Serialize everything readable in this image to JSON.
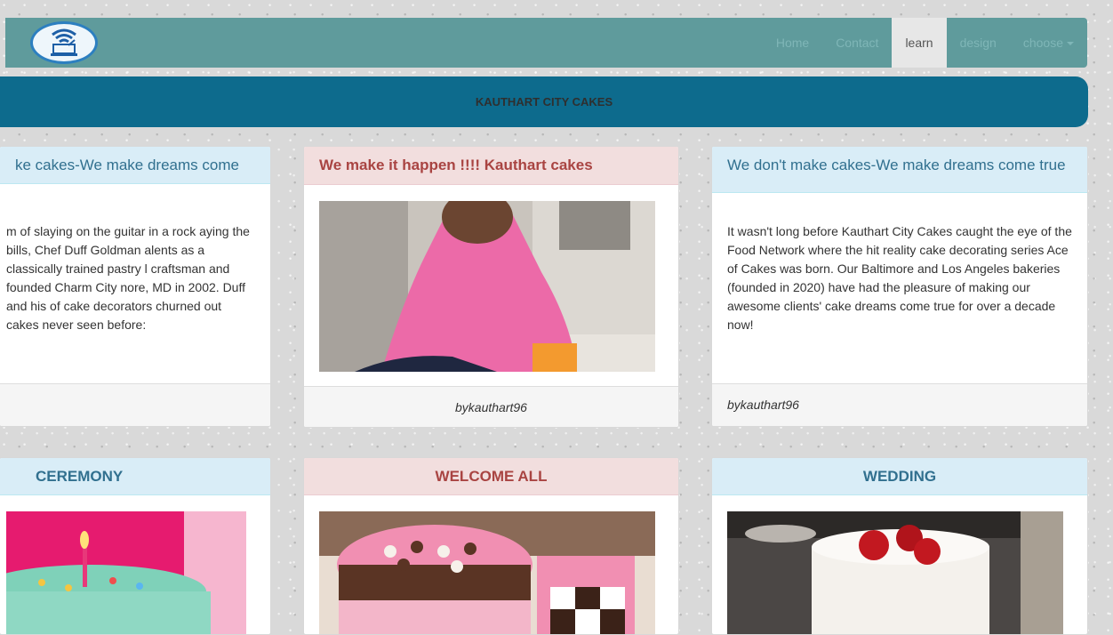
{
  "navbar": {
    "logo_icon": "wifi-laptop-logo",
    "items": [
      {
        "label": "Home",
        "active": false
      },
      {
        "label": "Contact",
        "active": false
      },
      {
        "label": "learn",
        "active": true
      },
      {
        "label": "design",
        "active": false
      },
      {
        "label": "choose",
        "active": false,
        "dropdown": true
      }
    ]
  },
  "banner": {
    "title": "KAUTHART CITY CAKES"
  },
  "cards": [
    {
      "heading": "ke cakes-We make dreams come",
      "heading_style": "info",
      "text": "m of slaying on the guitar in a rock aying the bills, Chef Duff Goldman alents as a classically trained pastry l craftsman and founded Charm City nore, MD in 2002. Duff and his of cake decorators churned out cakes never seen before:",
      "footer": ""
    },
    {
      "heading": "We make it happen !!!! Kauthart cakes",
      "heading_style": "danger",
      "image": "woman-in-pink-hijab-photo",
      "footer": "bykauthart96"
    },
    {
      "heading": "We don't make cakes-We make dreams come true",
      "heading_style": "info",
      "text": "It wasn't long before Kauthart City Cakes caught the eye of the Food Network where the hit reality cake decorating series Ace of Cakes was born. Our Baltimore and Los Angeles bakeries (founded in 2020) have had the pleasure of making our awesome clients' cake dreams come true for over a decade now!",
      "footer": "bykauthart96"
    }
  ],
  "cards_row2": [
    {
      "heading": "CEREMONY",
      "heading_style": "info",
      "image": "birthday-cake-candle-photo"
    },
    {
      "heading": "WELCOME ALL",
      "heading_style": "danger",
      "image": "pink-checkerboard-cake-photo"
    },
    {
      "heading": "WEDDING",
      "heading_style": "info",
      "image": "white-cake-red-roses-photo"
    }
  ],
  "colors": {
    "navbar": "#5f9b9c",
    "banner": "#0d6b8d",
    "info_heading": "#d9edf7",
    "danger_heading": "#f2dede"
  }
}
